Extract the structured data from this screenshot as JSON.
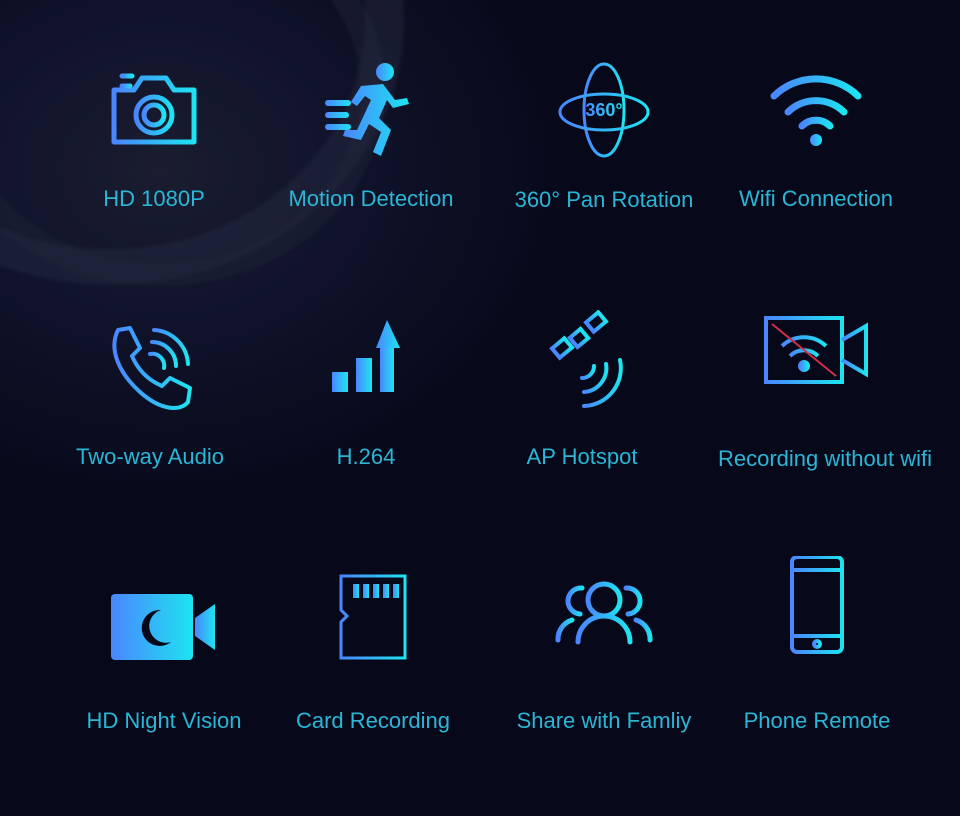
{
  "colors": {
    "background": "#07091a",
    "label": "#2bb6d6",
    "icon_gradient_start": "#4a86ff",
    "icon_gradient_end": "#1de4f0",
    "strike": "#d0304a"
  },
  "features": [
    {
      "label": "HD 1080P",
      "icon": "camera-icon"
    },
    {
      "label": "Motion Detection",
      "icon": "running-person-icon"
    },
    {
      "label": "360° Pan Rotation",
      "icon": "rotation-360-icon",
      "icon_text": "360°"
    },
    {
      "label": "Wifi Connection",
      "icon": "wifi-icon"
    },
    {
      "label": "Two-way Audio",
      "icon": "phone-call-icon"
    },
    {
      "label": "H.264",
      "icon": "signal-bars-icon"
    },
    {
      "label": "AP Hotspot",
      "icon": "satellite-icon"
    },
    {
      "label": "Recording without wifi",
      "icon": "video-no-wifi-icon"
    },
    {
      "label": "HD Night Vision",
      "icon": "night-video-icon"
    },
    {
      "label": "Card Recording",
      "icon": "sd-card-icon"
    },
    {
      "label": "Share with Famliy",
      "icon": "family-icon"
    },
    {
      "label": "Phone Remote",
      "icon": "smartphone-icon"
    }
  ]
}
